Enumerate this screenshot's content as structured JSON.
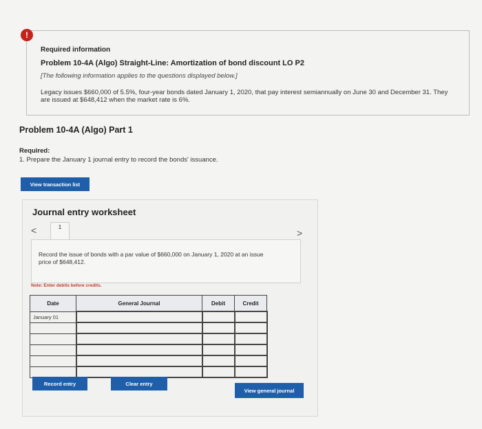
{
  "alert": {
    "icon": "!"
  },
  "info": {
    "required_title": "Required information",
    "problem_title": "Problem 10-4A (Algo) Straight-Line: Amortization of bond discount LO P2",
    "note": "[The following information applies to the questions displayed below.]",
    "description": "Legacy issues $660,000 of 5.5%, four-year bonds dated January 1, 2020, that pay interest semiannually on June 30 and December 31. They are issued at $648,412 when the market rate is 6%."
  },
  "part": {
    "title": "Problem 10-4A (Algo) Part 1",
    "required_label": "Required:",
    "required_text": "1. Prepare the January 1 journal entry to record the bonds' issuance."
  },
  "buttons": {
    "view_transaction_list": "View transaction list",
    "record_entry": "Record entry",
    "clear_entry": "Clear entry",
    "view_general_journal": "View general journal"
  },
  "worksheet": {
    "title": "Journal entry worksheet",
    "prev": "<",
    "next": ">",
    "page": "1",
    "record_text": "Record the issue of bonds with a par value of $660,000 on January 1, 2020 at an issue price of $648,412.",
    "note_label": "Note:",
    "note_text": " Enter debits before credits."
  },
  "journal": {
    "headers": {
      "date": "Date",
      "general_journal": "General Journal",
      "debit": "Debit",
      "credit": "Credit"
    },
    "rows": [
      {
        "date": "January 01",
        "account": "",
        "debit": "",
        "credit": ""
      },
      {
        "date": "",
        "account": "",
        "debit": "",
        "credit": ""
      },
      {
        "date": "",
        "account": "",
        "debit": "",
        "credit": ""
      },
      {
        "date": "",
        "account": "",
        "debit": "",
        "credit": ""
      },
      {
        "date": "",
        "account": "",
        "debit": "",
        "credit": ""
      },
      {
        "date": "",
        "account": "",
        "debit": "",
        "credit": ""
      }
    ]
  },
  "colors": {
    "accent": "#1f5fa9",
    "alert": "#c4231c"
  }
}
